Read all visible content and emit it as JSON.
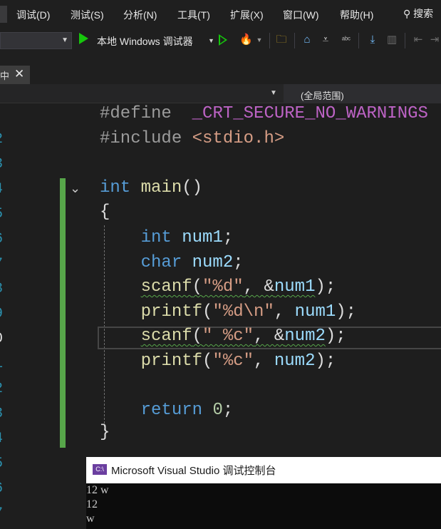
{
  "menu": {
    "items": [
      "调试(D)",
      "测试(S)",
      "分析(N)",
      "工具(T)",
      "扩展(X)",
      "窗口(W)",
      "帮助(H)"
    ],
    "search_label": "搜索"
  },
  "toolbar": {
    "debug_target": "本地 Windows 调试器"
  },
  "tab": {
    "label": "中",
    "close": "✕"
  },
  "navbar": {
    "scope": "(全局范围)"
  },
  "gutter": [
    "2",
    "3",
    "4",
    "5",
    "6",
    "7",
    "8",
    "9",
    "0",
    "1",
    "2",
    "3",
    "4",
    "5",
    "6",
    "7"
  ],
  "code": {
    "line1_directive": "#define",
    "line1_macro": "_CRT_SECURE_NO_WARNINGS",
    "line2_directive": "#include",
    "line2_header": "<stdio.h>",
    "line3_type": "int",
    "line3_name": "main",
    "line3_parens": "()",
    "line4": "{",
    "line5_type": "int",
    "line5_var": "num1",
    "line5_end": ";",
    "line6_type": "char",
    "line6_var": "num2",
    "line6_end": ";",
    "line7_fn": "scanf",
    "line7_open": "(",
    "line7_str": "\"%d\"",
    "line7_comma": ", &",
    "line7_var": "num1",
    "line7_end": ");",
    "line8_fn": "printf",
    "line8_open": "(",
    "line8_str": "\"%d\\n\"",
    "line8_comma": ", ",
    "line8_var": "num1",
    "line8_end": ");",
    "line9_fn": "scanf",
    "line9_open": "(",
    "line9_str": "\" %c\"",
    "line9_comma": ", &",
    "line9_var": "num2",
    "line9_end": ");",
    "line10_fn": "printf",
    "line10_open": "(",
    "line10_str": "\"%c\"",
    "line10_comma": ", ",
    "line10_var": "num2",
    "line10_end": ");",
    "line11_kw": "return",
    "line11_num": "0",
    "line11_end": ";",
    "line12": "}"
  },
  "console": {
    "title": "Microsoft Visual Studio 调试控制台",
    "icon": "C:\\",
    "lines": [
      "12 w",
      "12",
      "w"
    ]
  },
  "colors": {
    "editor_bg": "#1e1e1e",
    "keyword": "#569cd6",
    "function": "#dcdcaa",
    "variable": "#9cdcfe",
    "string": "#d69d85",
    "number": "#b5cea8",
    "macro": "#bd63c5",
    "change_bar": "#57a64a",
    "run_green": "#16c60c"
  },
  "icons": [
    "play-icon",
    "start-without-debug-icon",
    "solution-explorer-icon",
    "search-icon",
    "spellcheck-icon",
    "fold-chevron-icon"
  ]
}
